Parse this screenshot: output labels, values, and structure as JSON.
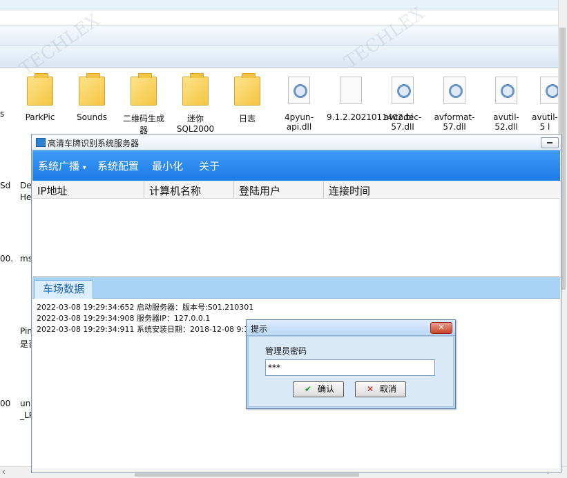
{
  "explorer": {
    "files": [
      {
        "name": "ParkPic",
        "type": "folder",
        "icon": "folder-icon"
      },
      {
        "name": "Sounds",
        "type": "folder",
        "icon": "folder-icon"
      },
      {
        "name": "二维码生成器",
        "type": "folder",
        "icon": "folder-icon"
      },
      {
        "name": "迷你SQL2000",
        "type": "folder",
        "icon": "folder-icon"
      },
      {
        "name": "日志",
        "type": "folder",
        "icon": "folder-icon"
      },
      {
        "name": "4pyun-api.dll",
        "type": "dll",
        "icon": "dll-gear-icon"
      },
      {
        "name": "9.1.2.2021011402.bi",
        "type": "file",
        "icon": "blank-file-icon"
      },
      {
        "name": "avcodec-57.dll",
        "type": "dll",
        "icon": "dll-gear-icon"
      },
      {
        "name": "avformat-57.dll",
        "type": "dll",
        "icon": "dll-gear-icon"
      },
      {
        "name": "avutil-52.dll",
        "type": "dll",
        "icon": "dll-gear-icon"
      },
      {
        "name": "avutil-5 l",
        "type": "dll",
        "icon": "dll-gear-icon"
      }
    ],
    "left_fragments": [
      "s",
      "Sd",
      "De",
      "He",
      "00.",
      "ms",
      "Pin",
      "是否",
      "un",
      "_LP",
      "00"
    ]
  },
  "window": {
    "title": "高清车牌识别系统服务器",
    "menu": [
      "系统广播",
      "系统配置",
      "最小化",
      "关于"
    ],
    "dropdown_marker": "▾",
    "columns": [
      "IP地址",
      "计算机名称",
      "登陆用户",
      "连接时间"
    ],
    "tab": "车场数据",
    "log": [
      "2022-03-08 19:29:34:652 启动服务器：版本号:S01.210301",
      "2022-03-08 19:29:34:908 服务器IP：127.0.0.1",
      "2022-03-08 19:29:34:911 系统安装日期：2018-12-08 9:17:13"
    ]
  },
  "dialog": {
    "title": "提示",
    "close": "✕",
    "label": "管理员密码",
    "password_value": "***",
    "ok": "确认",
    "cancel": "取消"
  },
  "watermark": "TECHLEX"
}
